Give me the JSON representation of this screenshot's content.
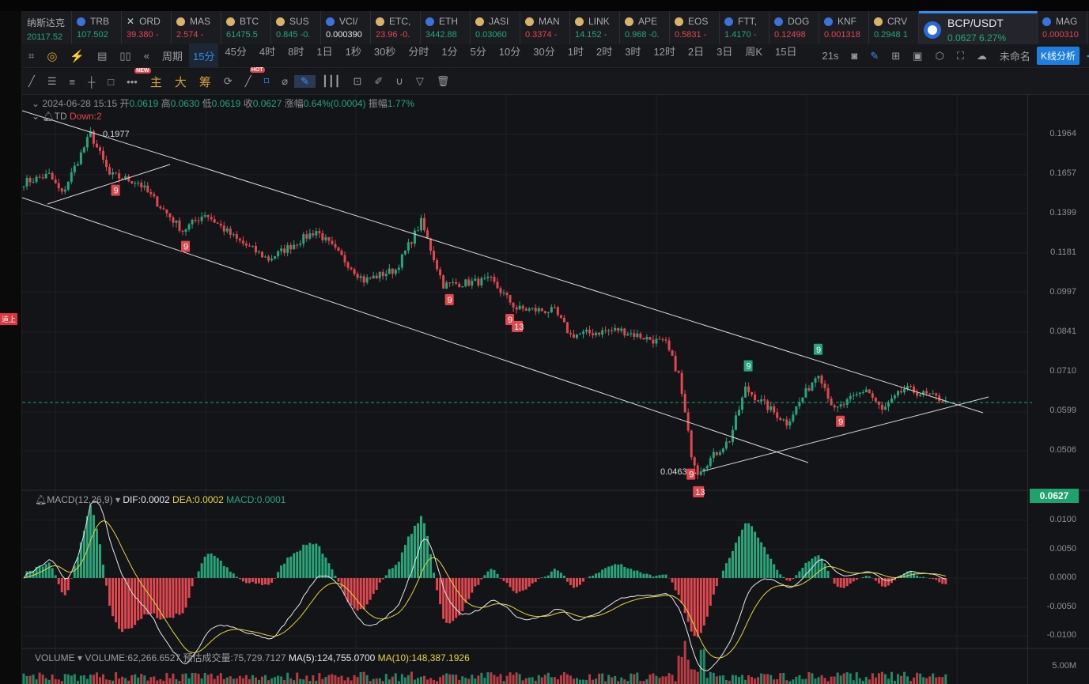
{
  "ticker": [
    {
      "sym": "纳斯达克",
      "price": "20117.52",
      "c": "g",
      "icon": "none"
    },
    {
      "sym": "TRB",
      "price": "107.502",
      "c": "g",
      "icon": "b"
    },
    {
      "sym": "ORD",
      "price": "39.380 -",
      "c": "r",
      "icon": "x"
    },
    {
      "sym": "MAS",
      "price": "2.574 -",
      "c": "r",
      "icon": "y"
    },
    {
      "sym": "BTC",
      "price": "61475.5",
      "c": "g",
      "icon": "y"
    },
    {
      "sym": "SUS",
      "price": "0.845 -0.",
      "c": "g",
      "icon": "y"
    },
    {
      "sym": "VCI/",
      "price": "0.000390",
      "c": "w",
      "icon": "b"
    },
    {
      "sym": "ETC,",
      "price": "23.96 -0.",
      "c": "r",
      "icon": "y"
    },
    {
      "sym": "ETH",
      "price": "3442.88",
      "c": "g",
      "icon": "b"
    },
    {
      "sym": "JASI",
      "price": "0.03060",
      "c": "g",
      "icon": "y"
    },
    {
      "sym": "MAN",
      "price": "0.3374 -",
      "c": "r",
      "icon": "y"
    },
    {
      "sym": "LINK",
      "price": "14.152 -",
      "c": "g",
      "icon": "y"
    },
    {
      "sym": "APE",
      "price": "0.968 -0.",
      "c": "g",
      "icon": "y"
    },
    {
      "sym": "EOS",
      "price": "0.5831 -",
      "c": "r",
      "icon": "y"
    },
    {
      "sym": "FTT,",
      "price": "1.4170 -",
      "c": "g",
      "icon": "b"
    },
    {
      "sym": "DOG",
      "price": "0.12498",
      "c": "r",
      "icon": "b"
    },
    {
      "sym": "KNF",
      "price": "0.001318",
      "c": "r",
      "icon": "b"
    },
    {
      "sym": "CRV",
      "price": "0.2948 1",
      "c": "g",
      "icon": "y"
    }
  ],
  "active": {
    "sym": "BCP/USDT",
    "price": "0.0627",
    "change": "6.27%"
  },
  "ticker_after": {
    "sym": "MAG",
    "price": "0.000310"
  },
  "toolbar": {
    "period": "周期",
    "intervals": [
      "15分",
      "45分",
      "4时",
      "8时",
      "1日",
      "1秒",
      "30秒",
      "分时",
      "1分",
      "5分",
      "10分",
      "30分",
      "1时",
      "2时",
      "3时",
      "12时",
      "2日",
      "3日",
      "周K",
      "15日"
    ],
    "selected": "15分",
    "countdown": "21s",
    "layout_name": "未命名",
    "analysis": "K线分析"
  },
  "draw_tools": {
    "new": "NEW",
    "hot": "HOT",
    "zhu": "主",
    "da": "大",
    "chou": "筹"
  },
  "sidebar": {
    "tag": "道上"
  },
  "ohlc": {
    "date": "2024-06-28 15:15",
    "open_l": "开",
    "open": "0.0619",
    "high_l": "高",
    "high": "0.0630",
    "low_l": "低",
    "low": "0.0619",
    "close_l": "收",
    "close": "0.0627",
    "chg_l": "涨幅",
    "chg": "0.64%(0.0004)",
    "amp_l": "振幅",
    "amp": "1.77%"
  },
  "td": {
    "name": "TD",
    "value": "Down:2"
  },
  "price_axis": [
    "0.1964",
    "0.1657",
    "0.1399",
    "0.1181",
    "0.0997",
    "0.0841",
    "0.0710",
    "0.0599",
    "0.0506"
  ],
  "current_price": "0.0627",
  "annotations": {
    "high": "0.1977",
    "low": "0.0463 →"
  },
  "td_marks": [
    {
      "t": "9",
      "c": "r",
      "i": 29
    },
    {
      "t": "9",
      "c": "r",
      "i": 51
    },
    {
      "t": "9",
      "c": "r",
      "i": 134
    },
    {
      "t": "9",
      "c": "r",
      "i": 153
    },
    {
      "t": "13",
      "c": "r",
      "i": 155
    },
    {
      "t": "9",
      "c": "r",
      "i": 210
    },
    {
      "t": "13",
      "c": "r",
      "i": 212
    },
    {
      "t": "9",
      "c": "g",
      "i": 228
    },
    {
      "t": "9",
      "c": "g",
      "i": 250
    },
    {
      "t": "9",
      "c": "r",
      "i": 257
    }
  ],
  "macd": {
    "name": "MACD(12,26,9)",
    "dif": "DIF:0.0002",
    "dea": "DEA:0.0002",
    "macd": "MACD:0.0001",
    "axis": [
      "0.0100",
      "0.0050",
      "0.0000",
      "-0.0050",
      "-0.0100"
    ]
  },
  "volume": {
    "name": "VOLUME",
    "vol": "VOLUME:62,266.6527",
    "est": "预估成交量:75,729.7127",
    "ma5": "MA(5):124,755.0700",
    "ma10": "MA(10):148,387.1926",
    "axis": "5.00M"
  },
  "chart_data": {
    "type": "candlestick",
    "interval": "15分",
    "scale": "log",
    "waypoints": [
      [
        0,
        0.16
      ],
      [
        8,
        0.165
      ],
      [
        12,
        0.152
      ],
      [
        21,
        0.197
      ],
      [
        27,
        0.165
      ],
      [
        36,
        0.16
      ],
      [
        50,
        0.13
      ],
      [
        57,
        0.14
      ],
      [
        67,
        0.125
      ],
      [
        77,
        0.115
      ],
      [
        92,
        0.13
      ],
      [
        107,
        0.105
      ],
      [
        117,
        0.11
      ],
      [
        125,
        0.135
      ],
      [
        132,
        0.103
      ],
      [
        147,
        0.105
      ],
      [
        155,
        0.093
      ],
      [
        167,
        0.092
      ],
      [
        172,
        0.083
      ],
      [
        187,
        0.085
      ],
      [
        202,
        0.08
      ],
      [
        206,
        0.07
      ],
      [
        210,
        0.05
      ],
      [
        212,
        0.0463
      ],
      [
        222,
        0.053
      ],
      [
        227,
        0.066
      ],
      [
        240,
        0.057
      ],
      [
        250,
        0.071
      ],
      [
        255,
        0.06
      ],
      [
        265,
        0.066
      ],
      [
        270,
        0.06
      ],
      [
        277,
        0.066
      ],
      [
        290,
        0.0627
      ]
    ],
    "ylim": [
      0.0463,
      0.1977
    ]
  }
}
